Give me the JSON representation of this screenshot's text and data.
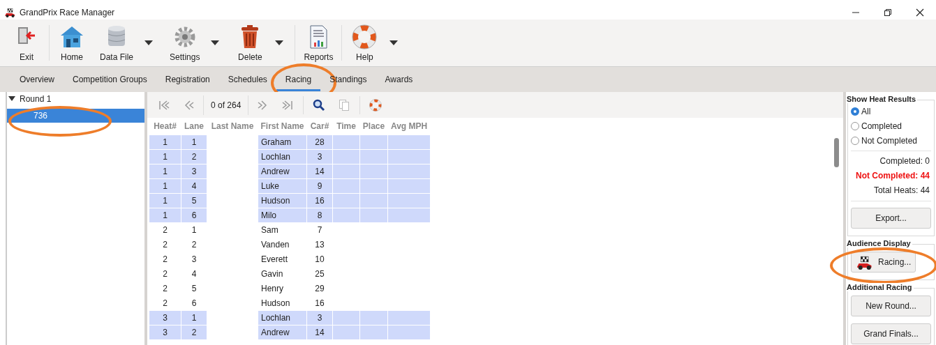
{
  "window": {
    "title": "GrandPrix Race Manager"
  },
  "toolbar": [
    [
      {
        "label": "Exit",
        "kind": "exit",
        "dropdown": false
      }
    ],
    [
      {
        "label": "Home",
        "kind": "home",
        "dropdown": false
      },
      {
        "label": "Data File",
        "kind": "database",
        "dropdown": true
      },
      {
        "label": "Settings",
        "kind": "gear",
        "dropdown": true
      },
      {
        "label": "Delete",
        "kind": "trash",
        "dropdown": true
      }
    ],
    [
      {
        "label": "Reports",
        "kind": "report",
        "dropdown": false
      }
    ],
    [
      {
        "label": "Help",
        "kind": "lifebuoy",
        "dropdown": true
      }
    ]
  ],
  "tabs": [
    {
      "label": "Overview",
      "selected": false,
      "circled": false
    },
    {
      "label": "Competition Groups",
      "selected": false,
      "circled": false
    },
    {
      "label": "Registration",
      "selected": false,
      "circled": false
    },
    {
      "label": "Schedules",
      "selected": false,
      "circled": false
    },
    {
      "label": "Racing",
      "selected": true,
      "circled": true
    },
    {
      "label": "Standings",
      "selected": false,
      "circled": false
    },
    {
      "label": "Awards",
      "selected": false,
      "circled": false
    }
  ],
  "tree": {
    "label": "Round 1",
    "expanded": true,
    "children": [
      {
        "label": "736",
        "selected": true,
        "circled": true
      }
    ]
  },
  "navigator": {
    "position": "0 of 264"
  },
  "table": {
    "columns": [
      "Heat#",
      "Lane",
      "Last Name",
      "First Name",
      "Car#",
      "Time",
      "Place",
      "Avg MPH"
    ],
    "rows": [
      {
        "heat": "1",
        "lane": "1",
        "first_name": "Graham",
        "car": "28",
        "shaded": true
      },
      {
        "heat": "1",
        "lane": "2",
        "first_name": "Lochlan",
        "car": "3",
        "shaded": true
      },
      {
        "heat": "1",
        "lane": "3",
        "first_name": "Andrew",
        "car": "14",
        "shaded": true
      },
      {
        "heat": "1",
        "lane": "4",
        "first_name": "Luke",
        "car": "9",
        "shaded": true
      },
      {
        "heat": "1",
        "lane": "5",
        "first_name": "Hudson",
        "car": "16",
        "shaded": true
      },
      {
        "heat": "1",
        "lane": "6",
        "first_name": "Milo",
        "car": "8",
        "shaded": true
      },
      {
        "heat": "2",
        "lane": "1",
        "first_name": "Sam",
        "car": "7",
        "shaded": false
      },
      {
        "heat": "2",
        "lane": "2",
        "first_name": "Vanden",
        "car": "13",
        "shaded": false
      },
      {
        "heat": "2",
        "lane": "3",
        "first_name": "Everett",
        "car": "10",
        "shaded": false
      },
      {
        "heat": "2",
        "lane": "4",
        "first_name": "Gavin",
        "car": "25",
        "shaded": false
      },
      {
        "heat": "2",
        "lane": "5",
        "first_name": "Henry",
        "car": "29",
        "shaded": false
      },
      {
        "heat": "2",
        "lane": "6",
        "first_name": "Hudson",
        "car": "16",
        "shaded": false
      },
      {
        "heat": "3",
        "lane": "1",
        "first_name": "Lochlan",
        "car": "3",
        "shaded": true
      },
      {
        "heat": "3",
        "lane": "2",
        "first_name": "Andrew",
        "car": "14",
        "shaded": true
      }
    ]
  },
  "heat_results": {
    "title": "Show Heat Results",
    "options": [
      {
        "label": "All",
        "selected": true
      },
      {
        "label": "Completed",
        "selected": false
      },
      {
        "label": "Not Completed",
        "selected": false
      }
    ],
    "stats": [
      {
        "label": "Completed:",
        "value": "0",
        "alert": false
      },
      {
        "label": "Not Completed:",
        "value": "44",
        "alert": true
      },
      {
        "label": "Total Heats:",
        "value": "44",
        "alert": false
      }
    ],
    "button": "Export..."
  },
  "audience_display": {
    "title": "Audience Display",
    "button": "Racing...",
    "circled": true
  },
  "additional_racing": {
    "title": "Additional Racing",
    "buttons": [
      "New Round...",
      "Grand Finals..."
    ]
  }
}
